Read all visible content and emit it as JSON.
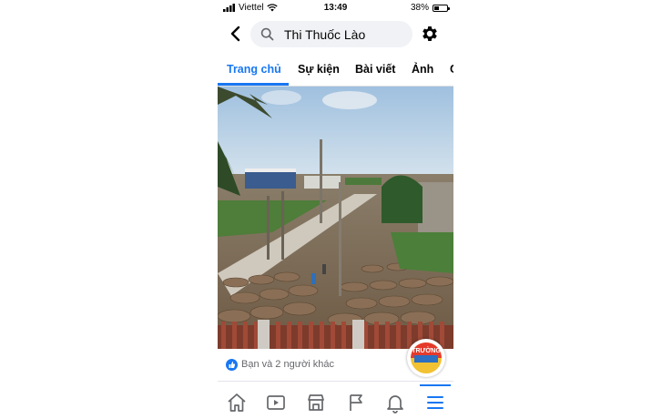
{
  "status_bar": {
    "carrier": "Viettel",
    "time": "13:49",
    "battery": "38%",
    "battery_level": 0.38,
    "icons": [
      "signal-bars-icon",
      "wifi-icon",
      "battery-icon"
    ]
  },
  "header": {
    "back_icon": "chevron-left-icon",
    "search_icon": "search-icon",
    "search_text": "Thi Thuốc Lào",
    "settings_icon": "gear-icon"
  },
  "tabs": [
    {
      "label": "Trang chủ",
      "active": true
    },
    {
      "label": "Sự kiện",
      "active": false
    },
    {
      "label": "Bài viết",
      "active": false
    },
    {
      "label": "Ảnh",
      "active": false
    },
    {
      "label": "C",
      "active": false
    }
  ],
  "post": {
    "reactions_text": "Bạn và 2 người khác",
    "like_icon": "like-thumb-icon",
    "page_logo_text": "TRƯỜNG"
  },
  "bottom_nav": [
    {
      "icon": "home-icon",
      "active": false
    },
    {
      "icon": "video-icon",
      "active": false
    },
    {
      "icon": "marketplace-icon",
      "active": false
    },
    {
      "icon": "flag-icon",
      "active": false
    },
    {
      "icon": "bell-icon",
      "active": false
    },
    {
      "icon": "menu-icon",
      "active": true
    }
  ],
  "colors": {
    "accent": "#1877f2",
    "search_bg": "#f0f2f5",
    "secondary_text": "#65676b"
  }
}
